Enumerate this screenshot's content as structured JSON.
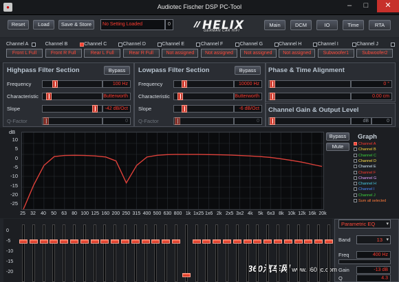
{
  "window": {
    "title": "Audiotec Fischer DSP PC-Tool",
    "min_icon": "minimize-icon",
    "max_icon": "maximize-icon",
    "close_icon": "close-icon"
  },
  "toolbar": {
    "reset": "Reset",
    "load": "Load",
    "save_store": "Save & Store",
    "setting_status": "No Setting Loaded",
    "setting_number": "0",
    "brand": "HELIX",
    "brand_sub": "GERMAN CAR HIFI",
    "nav": [
      "Main",
      "DCM",
      "IO",
      "Time",
      "RTA"
    ]
  },
  "channels": [
    {
      "name": "Channel A",
      "checked": false,
      "assign": "Front L Full"
    },
    {
      "name": "Channel B",
      "checked": true,
      "assign": "Front R Full"
    },
    {
      "name": "Channel C",
      "checked": false,
      "assign": "Rear L Full"
    },
    {
      "name": "Channel D",
      "checked": false,
      "assign": "Rear R Full"
    },
    {
      "name": "Channel E",
      "checked": false,
      "assign": "Not assigned"
    },
    {
      "name": "Channel F",
      "checked": false,
      "assign": "Not assigned"
    },
    {
      "name": "Channel G",
      "checked": false,
      "assign": "Not assigned"
    },
    {
      "name": "Channel H",
      "checked": false,
      "assign": "Not assigned"
    },
    {
      "name": "Channel I",
      "checked": false,
      "assign": "Subwoofer1"
    },
    {
      "name": "Channel J",
      "checked": false,
      "assign": "Subwoofer2"
    }
  ],
  "highpass": {
    "title": "Highpass Filter Section",
    "bypass": "Bypass",
    "frequency_label": "Frequency",
    "frequency_value": "100 Hz",
    "characteristic_label": "Characteristic",
    "characteristic_value": "Butterworth",
    "slope_label": "Slope",
    "slope_value": "-42 dB/Oct",
    "qfactor_label": "Q-Factor",
    "qfactor_value": "0"
  },
  "lowpass": {
    "title": "Lowpass Filter Section",
    "bypass": "Bypass",
    "frequency_label": "Frequency",
    "frequency_value": "10000 Hz",
    "characteristic_label": "Characteristic",
    "characteristic_value": "Butterworth",
    "slope_label": "Slope",
    "slope_value": "-6 dB/Oct",
    "qfactor_label": "Q-Factor",
    "qfactor_value": "0"
  },
  "phase_time": {
    "title": "Phase & Time Alignment",
    "phase_value": "0 °",
    "time_value": "0.00 cm"
  },
  "gain": {
    "title": "Channel Gain & Output Level",
    "unit": "dB",
    "value": "0"
  },
  "graph": {
    "ylabel": "dB",
    "yticks": [
      "10",
      "5",
      "0",
      "-5",
      "-10",
      "-15",
      "-20",
      "-25"
    ],
    "xticks": [
      "25",
      "32",
      "40",
      "50",
      "63",
      "80",
      "100",
      "125",
      "160",
      "200",
      "250",
      "315",
      "400",
      "500",
      "630",
      "800",
      "1k",
      "1x25",
      "1x6",
      "2k",
      "2x5",
      "3x2",
      "4k",
      "5k",
      "6x3",
      "8k",
      "10k",
      "12k",
      "16k",
      "20k"
    ],
    "bypass": "Bypass",
    "mute": "Mute",
    "legend_title": "Graph",
    "legend": [
      {
        "name": "Channel A",
        "color": "#ff3b2f",
        "checked": true
      },
      {
        "name": "Channel B",
        "color": "#ffd93a",
        "checked": false
      },
      {
        "name": "Channel C",
        "color": "#3dd63d",
        "checked": false
      },
      {
        "name": "Channel D",
        "color": "#ffe04a",
        "checked": false
      },
      {
        "name": "Channel E",
        "color": "#d8f0ff",
        "checked": false
      },
      {
        "name": "Channel F",
        "color": "#ff3b2f",
        "checked": false
      },
      {
        "name": "Channel G",
        "color": "#e0a0ff",
        "checked": false
      },
      {
        "name": "Channel H",
        "color": "#4ad0e8",
        "checked": false
      },
      {
        "name": "Channel I",
        "color": "#4a8aff",
        "checked": false
      },
      {
        "name": "Channel J",
        "color": "#3dd63d",
        "checked": false
      },
      {
        "name": "Sum all selected",
        "color": "#ff7a3a",
        "checked": false
      }
    ],
    "curve_color": "#e0413a",
    "curve_db": [
      -25,
      -14,
      -5,
      -1,
      -0.5,
      -0.4,
      -0.5,
      -0.7,
      -1.2,
      -3,
      -13,
      -5,
      -1.2,
      -0.4,
      -0.1,
      0,
      0,
      0,
      -0.1,
      -0.2,
      -0.3,
      -0.5,
      -0.7,
      -1,
      -1.4,
      -2,
      -2.7,
      -3.5,
      -4.5,
      -5.5
    ]
  },
  "eq": {
    "yticks": [
      "0",
      "-5",
      "-10",
      "-15",
      "-20"
    ],
    "gains_db": [
      0,
      0,
      0,
      0,
      0,
      0,
      0,
      0,
      0,
      0,
      0,
      0,
      0,
      0,
      0,
      0,
      -12,
      0,
      0,
      0,
      0,
      0,
      0,
      0,
      0,
      0,
      0,
      0,
      0,
      0,
      0
    ],
    "mode": "Parametric EQ",
    "band_label": "Band",
    "band_value": "13",
    "freq_label": "Freq",
    "freq_value": "400 Hz",
    "gain_label": "Gain",
    "gain_value": "-13 dB",
    "q_label": "Q",
    "q_value": "4.3"
  },
  "watermark": {
    "brand": "360汽车网",
    "url": "www.360qc.com"
  }
}
